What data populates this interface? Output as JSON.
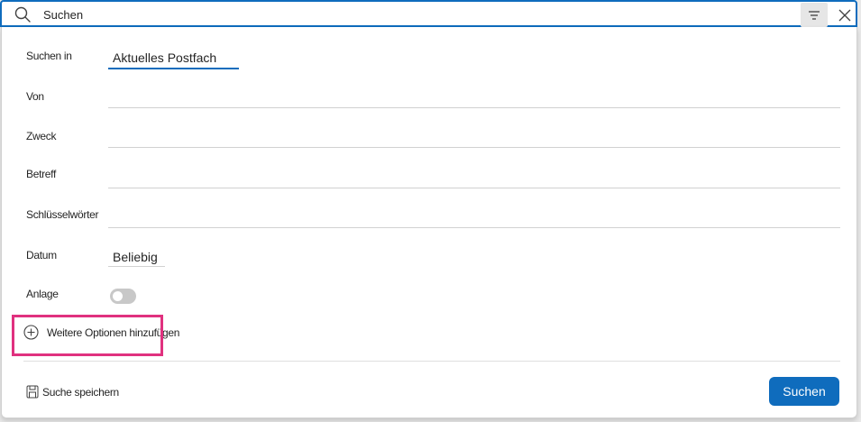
{
  "search_bar": {
    "query": "Suchen",
    "icons": [
      "search-icon",
      "filter-icon",
      "close-icon"
    ]
  },
  "form": {
    "search_in_label": "Suchen in",
    "search_in_value": "Aktuelles Postfach",
    "from_label": "Von",
    "to_label": "Zweck",
    "subject_label": "Betreff",
    "keywords_label": "Schlüsselwörter",
    "date_label": "Datum",
    "date_value": "Beliebig",
    "attachment_label": "Anlage",
    "attachment_toggle_on": false
  },
  "more_options_label": "Weitere Optionen hinzufügen",
  "save_search_label": "Suche speichern",
  "submit_label": "Suchen",
  "colors": {
    "accent": "#0f6cbd",
    "highlight": "#e0317f"
  }
}
